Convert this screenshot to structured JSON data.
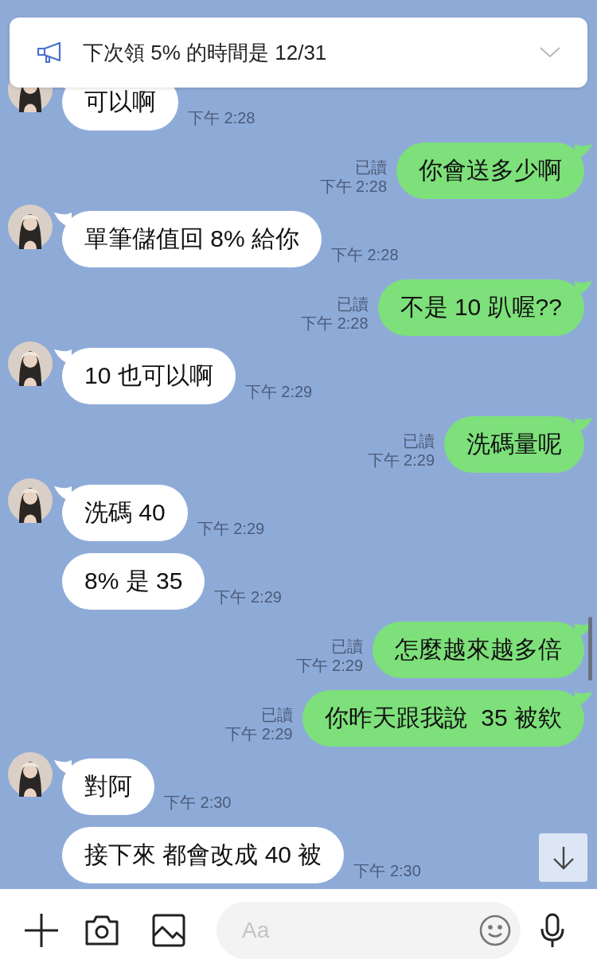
{
  "banner": {
    "text": "下次領 5% 的時間是 12/31"
  },
  "messages": [
    {
      "kind": "received",
      "avatar": true,
      "text": "可以啊",
      "time": "下午 2:28"
    },
    {
      "kind": "sent",
      "read": "已讀",
      "text": "你會送多少啊",
      "time": "下午 2:28"
    },
    {
      "kind": "received",
      "avatar": true,
      "text": "單筆儲值回 8% 給你",
      "time": "下午 2:28"
    },
    {
      "kind": "sent",
      "read": "已讀",
      "text": "不是 10 趴喔??",
      "time": "下午 2:28"
    },
    {
      "kind": "received",
      "avatar": true,
      "text": "10 也可以啊",
      "time": "下午 2:29"
    },
    {
      "kind": "sent",
      "read": "已讀",
      "text": "洗碼量呢",
      "time": "下午 2:29"
    },
    {
      "kind": "received",
      "avatar": true,
      "text": "洗碼 40",
      "time": "下午 2:29"
    },
    {
      "kind": "received",
      "avatar": false,
      "text": "8% 是 35",
      "time": "下午 2:29"
    },
    {
      "kind": "sent",
      "read": "已讀",
      "text": "怎麼越來越多倍",
      "time": "下午 2:29"
    },
    {
      "kind": "sent",
      "read": "已讀",
      "text": "你昨天跟我說  35 被欸",
      "time": "下午 2:29"
    },
    {
      "kind": "received",
      "avatar": true,
      "text": "對阿",
      "time": "下午 2:30"
    },
    {
      "kind": "received",
      "avatar": false,
      "text": "接下來 都會改成 40 被",
      "time": "下午 2:30"
    }
  ],
  "composer": {
    "placeholder": "Aa"
  }
}
